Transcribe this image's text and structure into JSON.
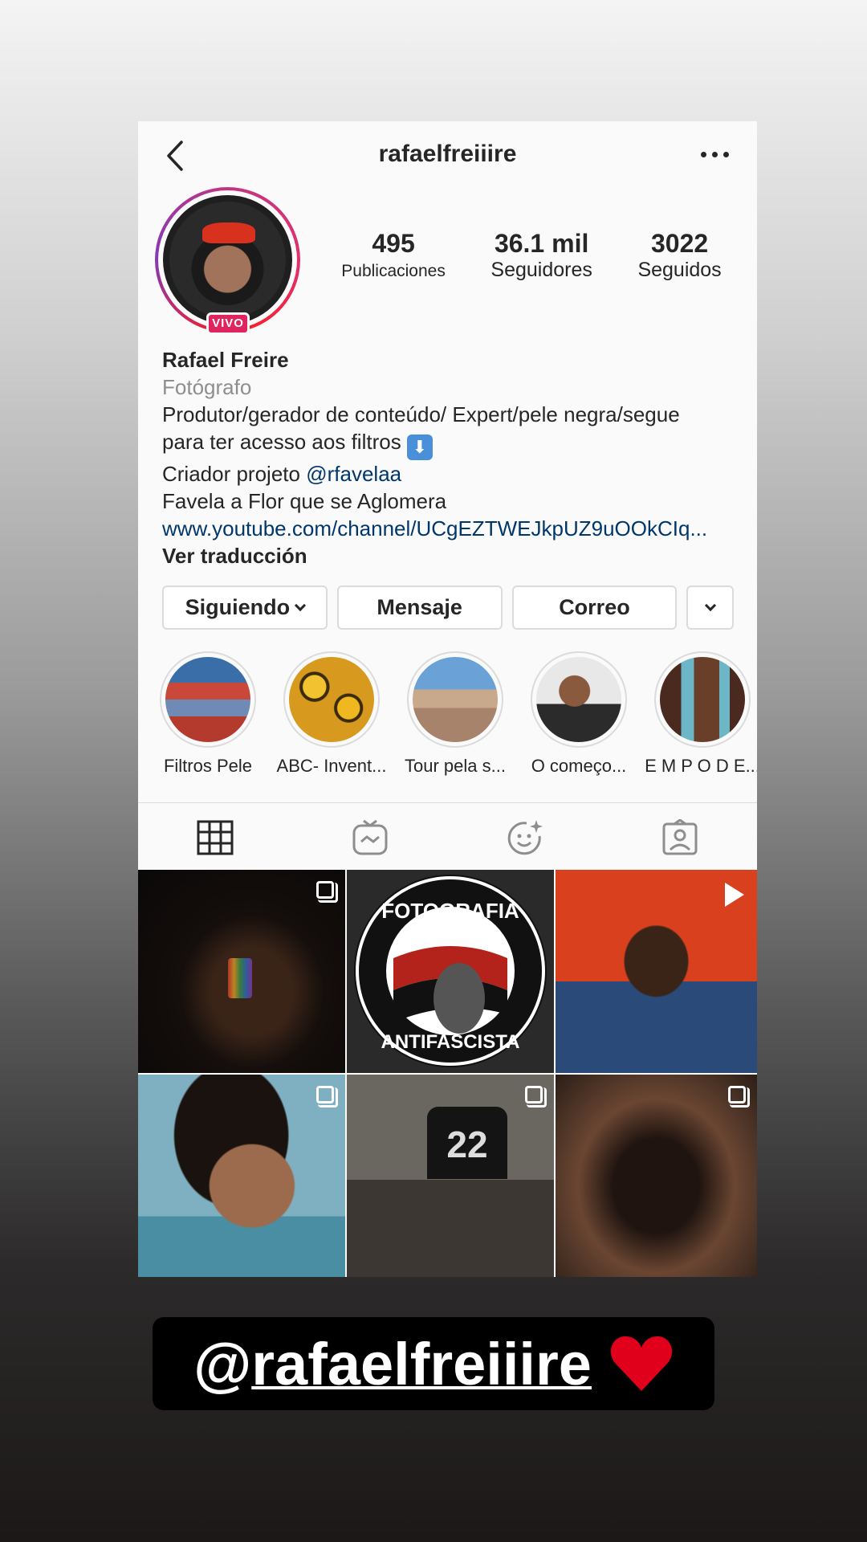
{
  "header": {
    "username": "rafaelfreiiire"
  },
  "profile": {
    "live_badge": "VIVO",
    "stats": [
      {
        "value": "495",
        "label": "Publicaciones"
      },
      {
        "value": "36.1 mil",
        "label": "Seguidores"
      },
      {
        "value": "3022",
        "label": "Seguidos"
      }
    ]
  },
  "bio": {
    "name": "Rafael Freire",
    "category": "Fotógrafo",
    "line1": "Produtor/gerador de conteúdo/ Expert/pele negra/segue",
    "line2": "para ter acesso aos filtros",
    "line3_prefix": "Criador projeto",
    "mention": "@rfavelaa",
    "line4": "Favela a Flor que se Aglomera",
    "link": "www.youtube.com/channel/UCgEZTWEJkpUZ9uOOkCIq...",
    "translate": "Ver traducción"
  },
  "actions": {
    "following": "Siguiendo",
    "message": "Mensaje",
    "email": "Correo"
  },
  "highlights": [
    {
      "label": "Filtros Pele"
    },
    {
      "label": "ABC- Invent..."
    },
    {
      "label": "Tour pela s..."
    },
    {
      "label": "O começo..."
    },
    {
      "label": "E M P O D E..."
    }
  ],
  "tabs": [
    "grid-icon",
    "igtv-icon",
    "effects-icon",
    "tagged-icon"
  ],
  "posts": {
    "badge_text": "FOTOGRAFIA",
    "badge_text_bottom": "ANTIFASCISTA",
    "jersey_number": "22"
  },
  "caption": {
    "at": "@",
    "user": "rafaelfreiiire"
  },
  "colors": {
    "link": "#00376b",
    "live": "#e0245e",
    "heart": "#e0001b"
  }
}
